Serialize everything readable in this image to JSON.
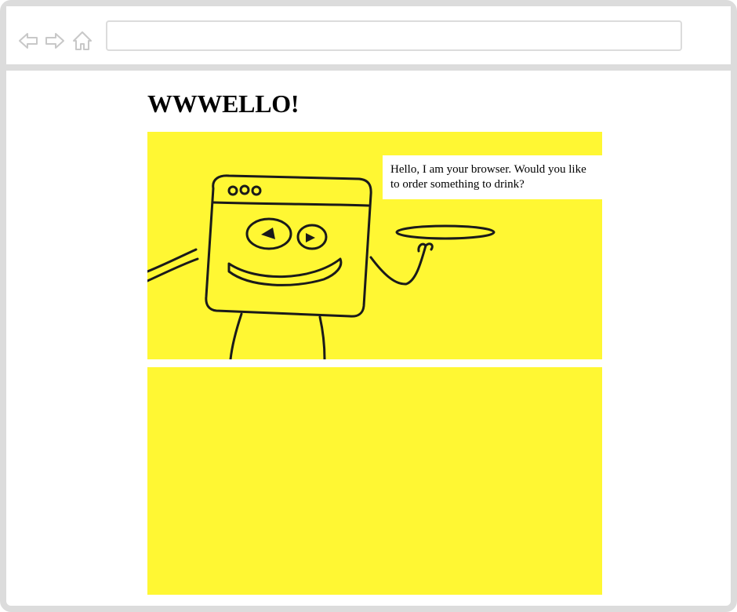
{
  "browser": {
    "address_bar_value": "",
    "icons": [
      "back-arrow-icon",
      "forward-arrow-icon",
      "home-icon"
    ]
  },
  "page": {
    "title": "WWWELLO!"
  },
  "panel1": {
    "speech": "Hello, I am your browser. Would you like to order something to drink?"
  },
  "colors": {
    "panel_background": "#fff733",
    "frame": "#dcdcdc",
    "text": "#000000"
  }
}
